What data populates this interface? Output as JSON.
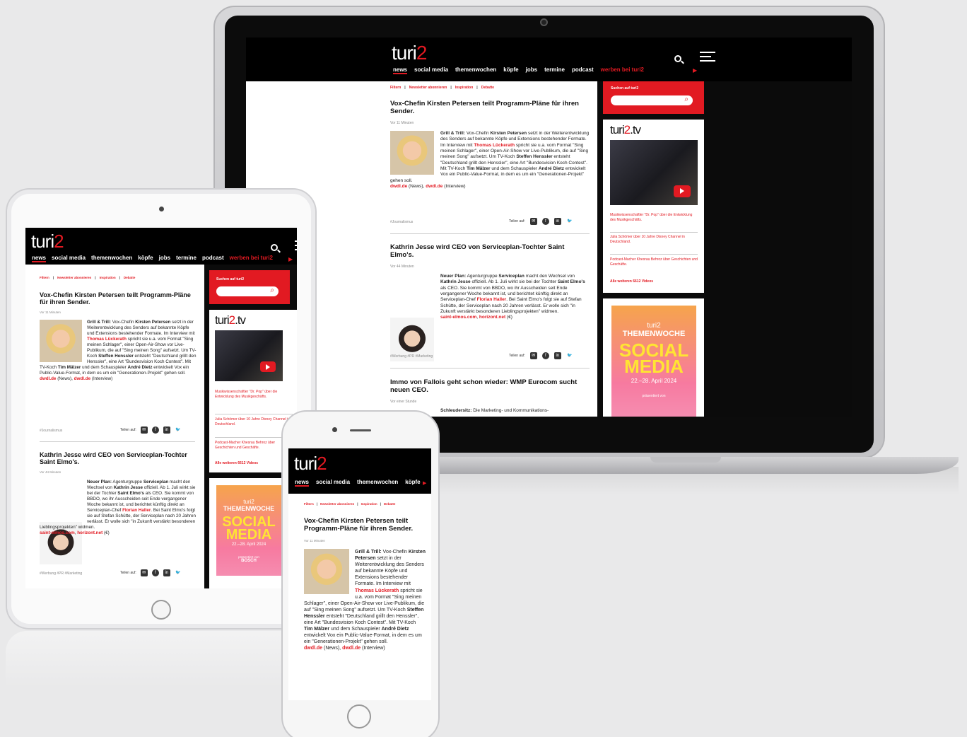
{
  "site": {
    "logo_text": "turi",
    "logo_num": "2",
    "nav": [
      "news",
      "social media",
      "themenwochen",
      "köpfe",
      "jobs",
      "termine",
      "podcast",
      "werben bei turi2"
    ],
    "filters": [
      "Filtern",
      "|",
      "Newsletter abonnieren",
      "|",
      "Inspiration",
      "|",
      "Debatte"
    ]
  },
  "articles": [
    {
      "title": "Vox-Chefin Kirsten Petersen teilt Programm-Pläne für ihren Sender.",
      "time": "Vor 11 Minuten",
      "p1_lead": "Grill & Trill:",
      "p1_a": " Vox-Chefin ",
      "p1_b": "Kirsten Petersen",
      "p1_c": " setzt in der Weiterentwicklung des Senders auf bekannte Köpfe und Extensions bestehender Formate. Im Interview mit ",
      "p1_d": "Thomas Lückerath",
      "p1_e": " spricht sie u.a. vom Format \"Sing meinen Schlager\", einer Open-Air-Show vor Live-Publikum, die auf \"Sing meinen Song\" aufsetzt. Um TV-Koch ",
      "p1_f": "Steffen Henssler",
      "p1_g": " entsteht \"Deutschland grillt den Henssler\", eine Art \"Bundesvision Koch Contest\". Mit TV-Koch ",
      "p1_h": "Tim Mälzer",
      "p1_i": " und dem Schauspieler ",
      "p1_j": "André Dietz",
      "p1_k": " entwickelt Vox ein Public-Value-Format, in dem es um ein \"Generationen-Projekt\" gehen soll.",
      "src1": "dwdl.de",
      "src1_note": " (News), ",
      "src2": "dwdl.de",
      "src2_note": " (Interview)",
      "tags": "#Journalismus",
      "share": "Teilen auf:"
    },
    {
      "title": "Kathrin Jesse wird CEO von Serviceplan-Tochter Saint Elmo's.",
      "time": "Vor 44 Minuten",
      "p_lead": "Neuer Plan:",
      "p_a": " Agenturgruppe ",
      "p_b": "Serviceplan",
      "p_c": " macht den Wechsel von ",
      "p_d": "Kathrin Jesse",
      "p_e": " offiziell. Ab 1. Juli wirkt sie bei der Tochter ",
      "p_f": "Saint Elmo's",
      "p_g": " als CEO. Sie kommt von BBDO, wo ihr Ausscheiden seit Ende vergangener Woche bekannt ist, und berichtet künftig direkt an Serviceplan-Chef ",
      "p_h": "Florian Haller",
      "p_i": ". Bei Saint Elmo's folgt sie auf Stefan Schütte, der Serviceplan nach 20 Jahren verlässt. Er wolle sich \"in Zukunft verstärkt besonderen Lieblingsprojekten\" widmen.",
      "src1": "saint-elmos.com",
      "src2": "horizont.net",
      "src2_note": " (€)",
      "tags": "#Werbung  #PR  #Marketing",
      "share": "Teilen auf:"
    },
    {
      "title": "Immo von Fallois geht schon wieder: WMP Eurocom sucht neuen CEO.",
      "time": "Vor einer Stunde",
      "p_lead": "Schleudersitz:",
      "p_a": " Die Marketing- und Kommunikations-"
    }
  ],
  "sidebar": {
    "search_label": "Suchen auf turi2",
    "tv_logo": "turi",
    "tv_logo_num": "2",
    "tv_logo_suffix": ".tv",
    "links": [
      "Musikwissenschaftler \"Dr. Pop\" über die Entwicklung des Musikgeschäfts.",
      "Julia Schömer über 10 Jahre Disney Channel in Deutschland.",
      "Podcast-Macher Khesrau Behroz über Geschichten und Geschäfte."
    ],
    "more": "Alle weiteren 6612 Videos",
    "poster": {
      "small": "turi2",
      "theme": "THEMENWOCHE",
      "big1": "SOCIAL",
      "big2": "MEDIA",
      "dates": "22.–28. April 2024",
      "presented": "präsentiert von",
      "sponsor": "BOSCH"
    }
  },
  "colors": {
    "accent": "#e21a22",
    "header": "#000000",
    "background": "#e9e9ea"
  }
}
